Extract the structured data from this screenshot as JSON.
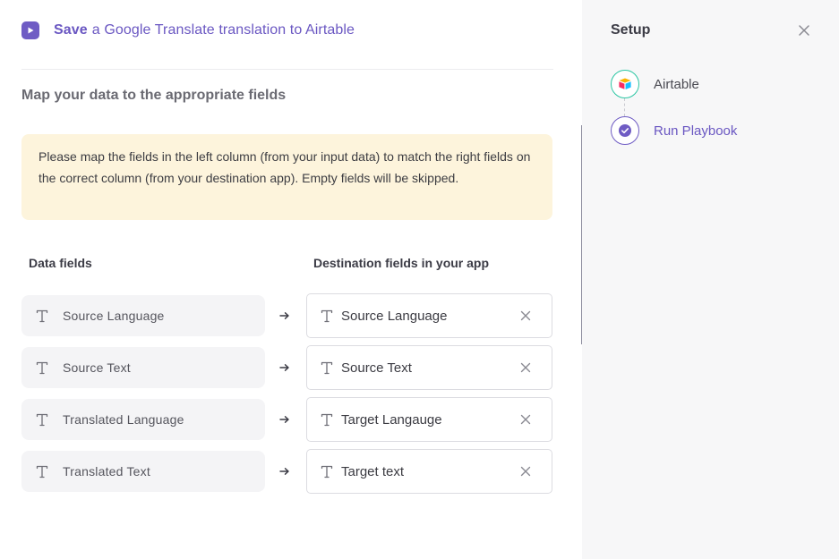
{
  "header": {
    "action": "Save",
    "title_rest": "a Google Translate translation to Airtable",
    "icon": "play-icon"
  },
  "section_title": "Map your data to the appropriate fields",
  "notice": "Please map the fields in the left column (from your input data) to match the right fields on the correct column (from your destination app). Empty fields will be skipped.",
  "columns": {
    "left": "Data fields",
    "right": "Destination fields in your app"
  },
  "mappings": [
    {
      "source": "Source Language",
      "destination": "Source Language"
    },
    {
      "source": "Source Text",
      "destination": "Source Text"
    },
    {
      "source": "Translated Language",
      "destination": "Target Langauge"
    },
    {
      "source": "Translated Text",
      "destination": "Target text"
    }
  ],
  "sidebar": {
    "title": "Setup",
    "steps": [
      {
        "label": "Airtable",
        "icon": "airtable-logo-icon"
      },
      {
        "label": "Run Playbook",
        "icon": "check-circle-icon"
      }
    ]
  },
  "colors": {
    "accent": "#6f5cc4",
    "notice_bg": "#fdf4dc",
    "airtable_ring": "#2cc6a3",
    "sidebar_bg": "#f7f7f8"
  }
}
